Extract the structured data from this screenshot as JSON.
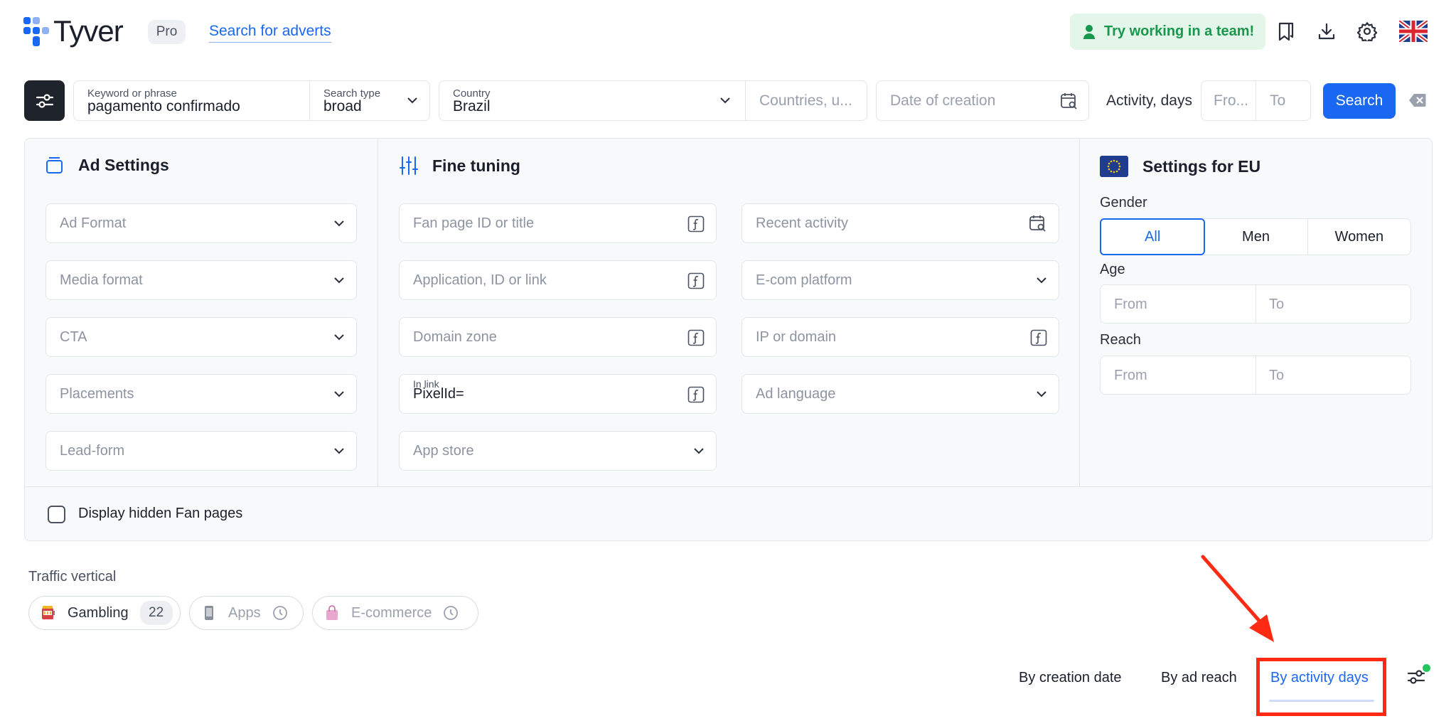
{
  "header": {
    "logo_text": "Tyver",
    "plan_badge": "Pro",
    "search_link": "Search for adverts",
    "team_button": "Try working in a team!",
    "icons": [
      "bookmark-icon",
      "download-icon",
      "gear-icon",
      "uk-flag-icon"
    ]
  },
  "search": {
    "keyword_label": "Keyword or phrase",
    "keyword_value": "pagamento confirmado",
    "type_label": "Search type",
    "type_value": "broad",
    "country_label": "Country",
    "country_value": "Brazil",
    "countries_placeholder": "Countries, u...",
    "date_placeholder": "Date of creation",
    "activity_label": "Activity, days",
    "from_placeholder": "Fro...",
    "to_placeholder": "To",
    "search_button": "Search"
  },
  "ad_settings": {
    "title": "Ad Settings",
    "fields": [
      "Ad Format",
      "Media format",
      "CTA",
      "Placements",
      "Lead-form"
    ]
  },
  "fine_tuning": {
    "title": "Fine tuning",
    "left": [
      {
        "placeholder": "Fan page ID or title"
      },
      {
        "placeholder": "Application, ID or link"
      },
      {
        "placeholder": "Domain zone"
      },
      {
        "label": "In link",
        "value": "PixelId="
      },
      {
        "placeholder": "App store"
      }
    ],
    "right": [
      "Recent activity",
      "E-com platform",
      "IP or domain",
      "Ad language"
    ]
  },
  "eu_settings": {
    "title": "Settings for EU",
    "gender_label": "Gender",
    "gender_options": [
      "All",
      "Men",
      "Women"
    ],
    "gender_selected": "All",
    "age_label": "Age",
    "reach_label": "Reach",
    "from": "From",
    "to": "To"
  },
  "hidden_pages": {
    "label": "Display hidden Fan pages",
    "checked": false
  },
  "traffic": {
    "label": "Traffic vertical",
    "chips": [
      {
        "label": "Gambling",
        "count": "22",
        "icon": "slot-machine-icon"
      },
      {
        "label": "Apps",
        "icon": "phone-icon"
      },
      {
        "label": "E-commerce",
        "icon": "shopping-bag-icon"
      }
    ]
  },
  "sort": {
    "tabs": [
      "By creation date",
      "By ad reach",
      "By activity days"
    ],
    "active": "By activity days"
  },
  "colors": {
    "accent": "#1a67f2",
    "dark": "#1f232b",
    "team_bg": "#e4f5ea",
    "team_text": "#18984d",
    "annotation": "#ff2a13"
  }
}
